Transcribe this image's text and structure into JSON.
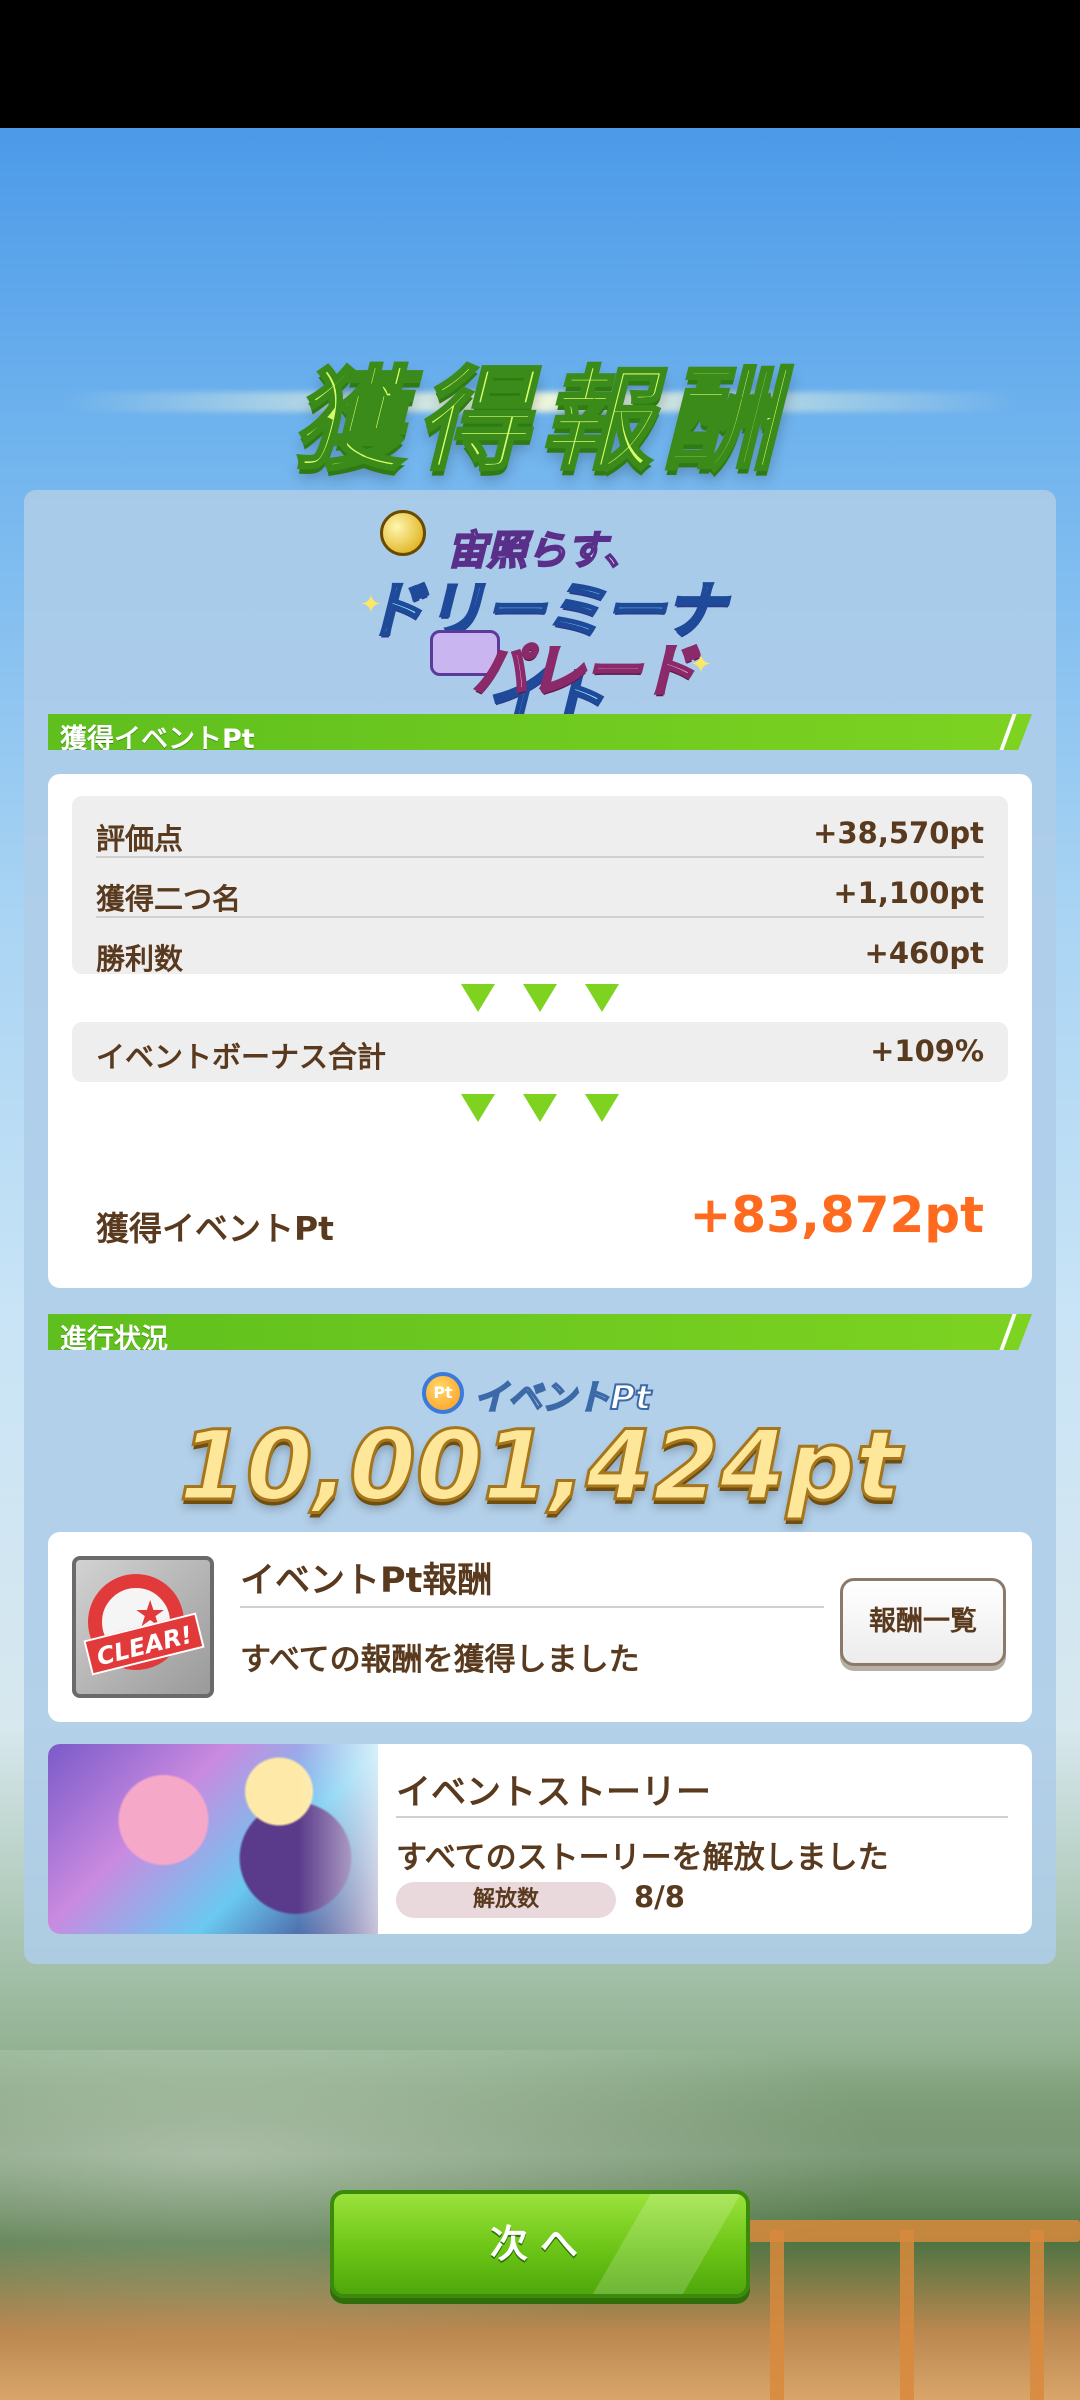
{
  "title": "獲得報酬",
  "event_logo": {
    "line1": "宙照らす、",
    "line2": "ドリーミーナイト",
    "line3": "パレード"
  },
  "points_section": {
    "header": "獲得イベントPt",
    "rows": [
      {
        "label": "評価点",
        "value": "+38,570pt"
      },
      {
        "label": "獲得二つ名",
        "value": "+1,100pt"
      },
      {
        "label": "勝利数",
        "value": "+460pt"
      }
    ],
    "bonus": {
      "label": "イベントボーナス合計",
      "value": "+109%"
    },
    "total": {
      "label": "獲得イベントPt",
      "value": "+83,872pt"
    }
  },
  "progress_section": {
    "header": "進行状況",
    "pt_icon": "Pt",
    "pt_label": "イベントPt",
    "pt_total": "10,001,424pt",
    "reward_card": {
      "badge_text": "CLEAR!",
      "title": "イベントPt報酬",
      "subtitle": "すべての報酬を獲得しました",
      "button_label": "報酬一覧"
    },
    "story_card": {
      "title": "イベントストーリー",
      "subtitle": "すべてのストーリーを解放しました",
      "unlock_label": "解放数",
      "unlock_count": "8/8"
    }
  },
  "next_button": "次へ"
}
